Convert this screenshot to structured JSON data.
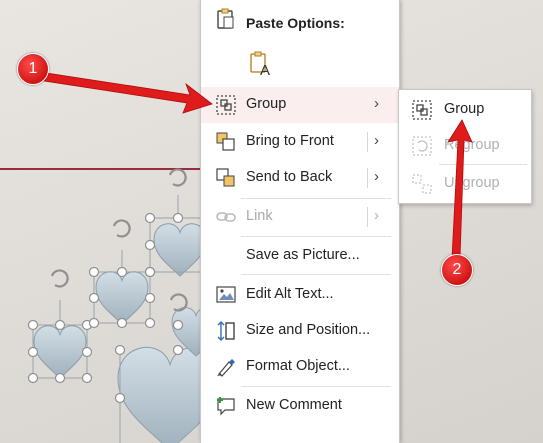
{
  "context_menu": {
    "paste_options_title": "Paste Options:",
    "items": [
      {
        "label": "Group",
        "icon": "group-icon",
        "has_submenu": true,
        "disabled": false,
        "highlighted": true
      },
      {
        "label": "Bring to Front",
        "icon": "bring-to-front-icon",
        "has_submenu": true,
        "disabled": false
      },
      {
        "label": "Send to Back",
        "icon": "send-to-back-icon",
        "has_submenu": true,
        "disabled": false
      },
      {
        "label": "Link",
        "icon": "link-icon",
        "has_submenu": true,
        "disabled": true
      },
      {
        "label": "Save as Picture...",
        "icon": "",
        "has_submenu": false,
        "disabled": false
      },
      {
        "label": "Edit Alt Text...",
        "icon": "alt-text-icon",
        "has_submenu": false,
        "disabled": false
      },
      {
        "label": "Size and Position...",
        "icon": "size-position-icon",
        "has_submenu": false,
        "disabled": false
      },
      {
        "label": "Format Object...",
        "icon": "format-object-icon",
        "has_submenu": false,
        "disabled": false
      },
      {
        "label": "New Comment",
        "icon": "new-comment-icon",
        "has_submenu": false,
        "disabled": false
      }
    ]
  },
  "group_submenu": {
    "items": [
      {
        "label": "Group",
        "icon": "group-icon",
        "disabled": false
      },
      {
        "label": "Regroup",
        "icon": "regroup-icon",
        "disabled": true
      },
      {
        "label": "Ungroup",
        "icon": "ungroup-icon",
        "disabled": true
      }
    ]
  },
  "callouts": {
    "one": "1",
    "two": "2"
  },
  "colors": {
    "callout": "#e01b1b",
    "highlight": "#fbeeee",
    "accent_rule": "#9a2a3e",
    "heart_fill": "#b9c8d2"
  }
}
